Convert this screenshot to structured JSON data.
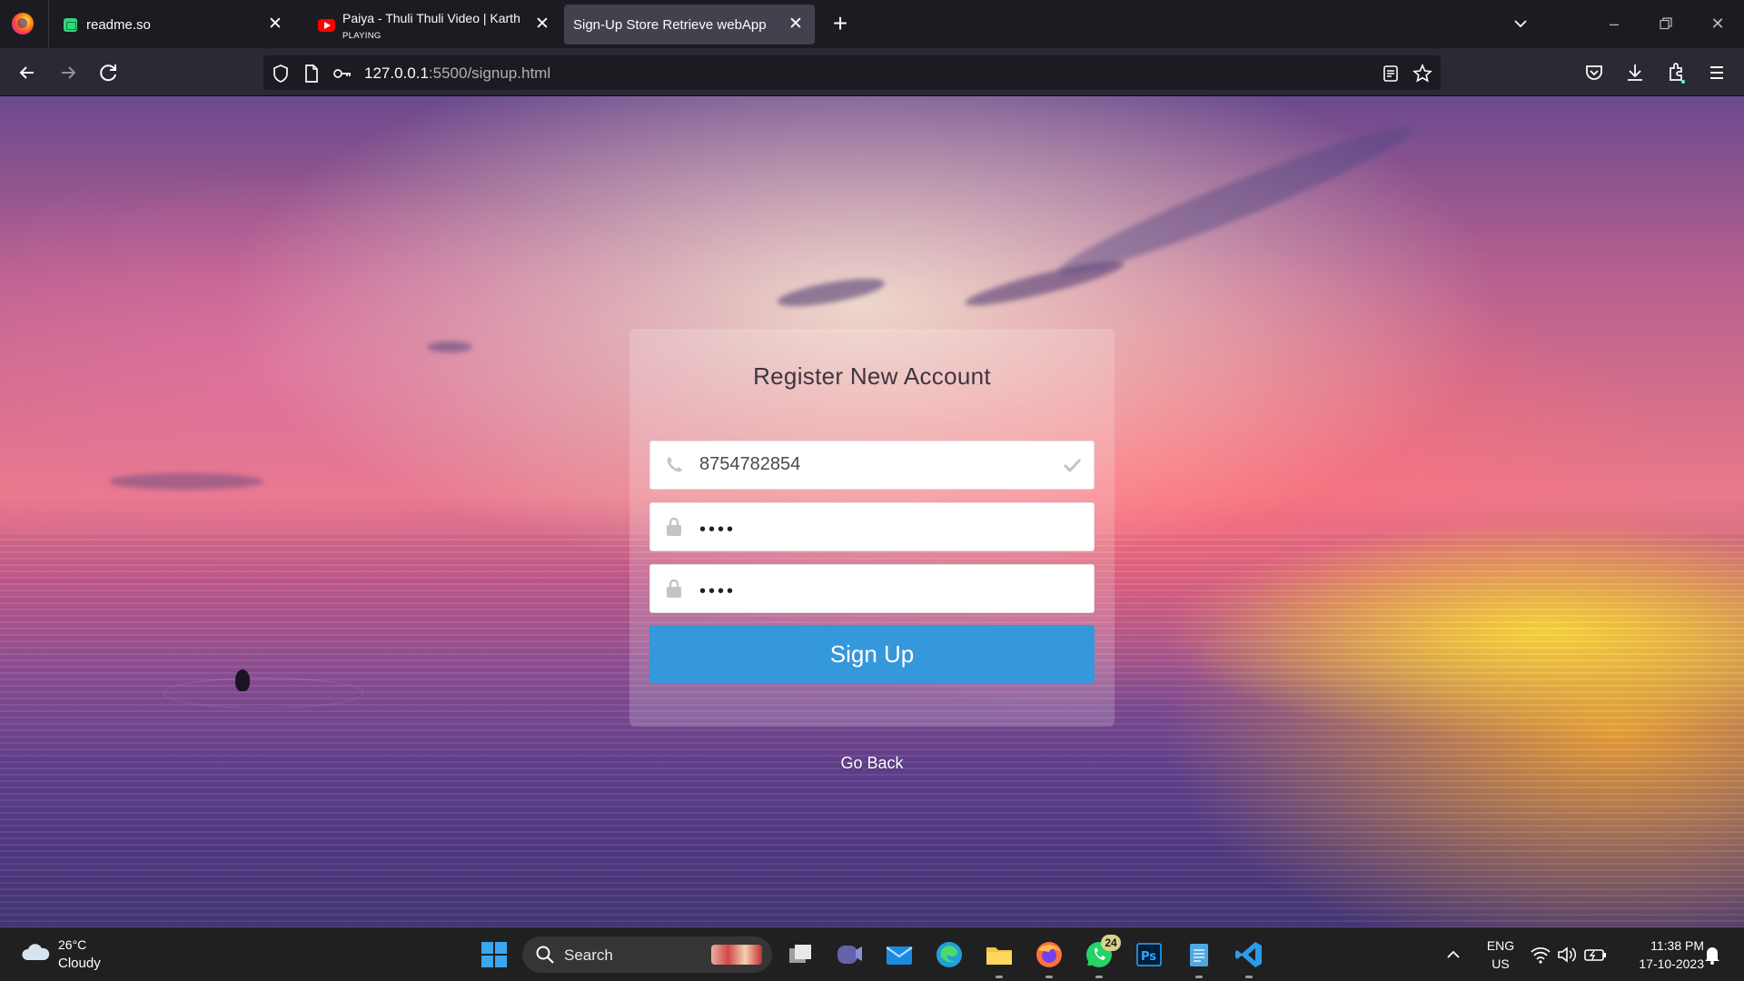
{
  "browser": {
    "tabs": [
      {
        "title": "readme.so",
        "sub": ""
      },
      {
        "title": "Paiya - Thuli Thuli Video | Karth",
        "sub": "PLAYING"
      },
      {
        "title": "Sign-Up Store Retrieve webApp",
        "sub": ""
      }
    ],
    "url": {
      "host": "127.0.0.1",
      "path": ":5500/signup.html"
    }
  },
  "page": {
    "heading": "Register New Account",
    "phone_value": "8754782854",
    "password_mask": "••••",
    "confirm_mask": "••••",
    "signup_label": "Sign Up",
    "go_back_label": "Go Back"
  },
  "taskbar": {
    "weather": {
      "temp": "26°C",
      "desc": "Cloudy"
    },
    "search_label": "Search",
    "whatsapp_badge": "24",
    "language": {
      "lang": "ENG",
      "region": "US"
    },
    "clock": {
      "time": "11:38 PM",
      "date": "17-10-2023"
    }
  },
  "colors": {
    "signup_button": "#3498db",
    "tab_active": "#42414d",
    "browser_chrome": "#2b2a33",
    "taskbar": "#202020"
  }
}
